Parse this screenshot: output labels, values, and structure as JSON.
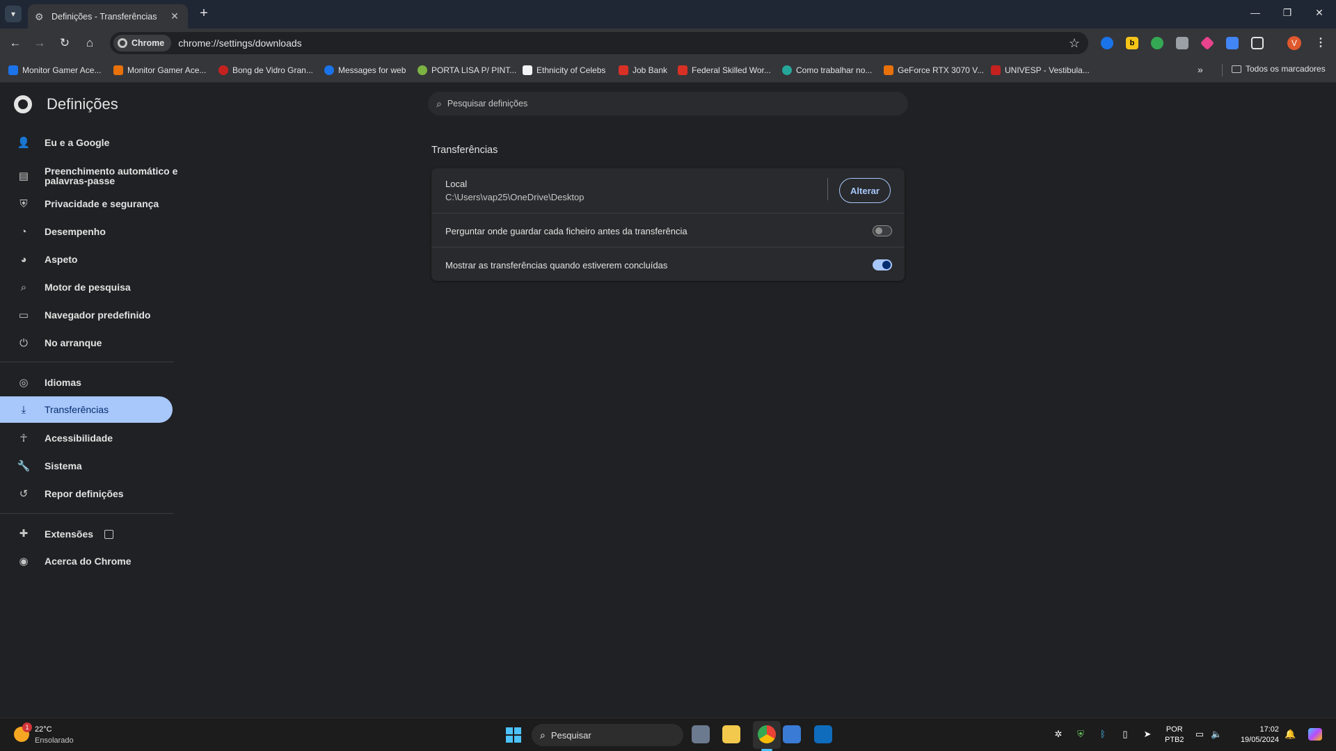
{
  "browser": {
    "tab_title": "Definições - Transferências",
    "tab_close": "✕",
    "new_tab": "+",
    "omnibox_chip": "Chrome",
    "url": "chrome://settings/downloads",
    "avatar_letter": "V",
    "ext_b_label": "b",
    "window_controls": [
      "—",
      "❐",
      "✕"
    ]
  },
  "bookmarks": {
    "items": [
      "Monitor Gamer Ace...",
      "Monitor Gamer Ace...",
      "Bong de Vidro Gran...",
      "Messages for web",
      "PORTA LISA P/ PINT...",
      "Ethnicity of Celebs",
      "Job Bank",
      "Federal Skilled Wor...",
      "Como trabalhar no...",
      "GeForce RTX 3070 V...",
      "UNIVESP - Vestibula..."
    ],
    "overflow": "»",
    "all_bookmarks": "Todos os marcadores"
  },
  "settings": {
    "title": "Definições",
    "search_placeholder": "Pesquisar definições",
    "nav": [
      "Eu e a Google",
      "Preenchimento automático e palavras-passe",
      "Privacidade e segurança",
      "Desempenho",
      "Aspeto",
      "Motor de pesquisa",
      "Navegador predefinido",
      "No arranque",
      "Idiomas",
      "Transferências",
      "Acessibilidade",
      "Sistema",
      "Repor definições",
      "Extensões",
      "Acerca do Chrome"
    ],
    "section_title": "Transferências",
    "location_label": "Local",
    "location_path": "C:\\Users\\vap25\\OneDrive\\Desktop",
    "change_button": "Alterar",
    "ask_where_label": "Perguntar onde guardar cada ficheiro antes da transferência",
    "ask_where_enabled": false,
    "show_downloads_label": "Mostrar as transferências quando estiverem concluídas",
    "show_downloads_enabled": true
  },
  "taskbar": {
    "weather_badge": "1",
    "temperature": "22°C",
    "condition": "Ensolarado",
    "search_placeholder": "Pesquisar",
    "lang_line1": "POR",
    "lang_line2": "PTB2",
    "time": "17:02",
    "date": "19/05/2024"
  },
  "colors": {
    "accent": "#a8c7fa",
    "background": "#202124",
    "card": "#292a2d",
    "tab_strip": "#1f2735"
  }
}
